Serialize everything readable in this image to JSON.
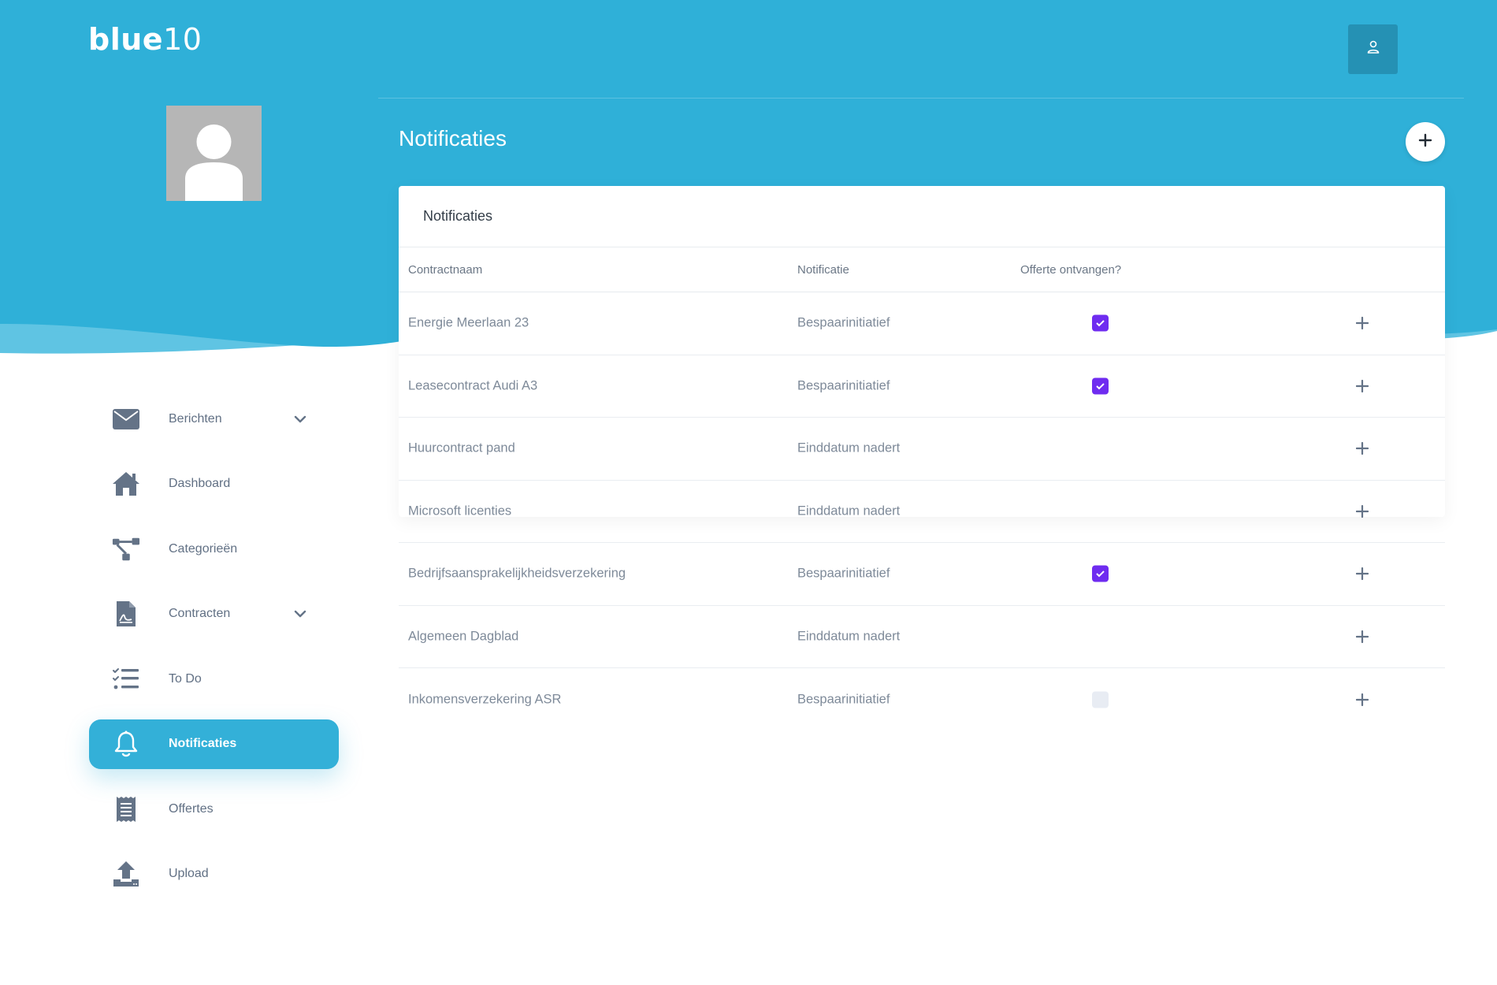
{
  "brand": {
    "logo_bold": "blue",
    "logo_light": "10"
  },
  "header": {
    "user_icon": "user-icon",
    "title": "Notificaties",
    "add_icon": "plus-icon"
  },
  "sidebar": {
    "items": [
      {
        "label": "Berichten",
        "icon": "envelope-icon",
        "has_chevron": true,
        "active": false
      },
      {
        "label": "Dashboard",
        "icon": "home-icon",
        "has_chevron": false,
        "active": false
      },
      {
        "label": "Categorieën",
        "icon": "sitemap-icon",
        "has_chevron": false,
        "active": false
      },
      {
        "label": "Contracten",
        "icon": "contract-file-icon",
        "has_chevron": true,
        "active": false
      },
      {
        "label": "To Do",
        "icon": "checklist-icon",
        "has_chevron": false,
        "active": false
      },
      {
        "label": "Notificaties",
        "icon": "bell-icon",
        "has_chevron": false,
        "active": true
      },
      {
        "label": "Offertes",
        "icon": "receipt-icon",
        "has_chevron": false,
        "active": false
      },
      {
        "label": "Upload",
        "icon": "upload-icon",
        "has_chevron": false,
        "active": false
      }
    ]
  },
  "card": {
    "title": "Notificaties"
  },
  "table": {
    "columns": [
      "Contractnaam",
      "Notificatie",
      "Offerte ontvangen?"
    ],
    "rows": [
      {
        "contract": "Energie Meerlaan 23",
        "notification": "Bespaarinitiatief",
        "quote": "checked"
      },
      {
        "contract": "Leasecontract Audi A3",
        "notification": "Bespaarinitiatief",
        "quote": "checked"
      },
      {
        "contract": "Huurcontract pand",
        "notification": "Einddatum nadert",
        "quote": "none"
      },
      {
        "contract": "Microsoft licenties",
        "notification": "Einddatum nadert",
        "quote": "none"
      },
      {
        "contract": "Bedrijfsaansprakelijkheidsverzekering",
        "notification": "Bespaarinitiatief",
        "quote": "checked"
      },
      {
        "contract": "Algemeen Dagblad",
        "notification": "Einddatum nadert",
        "quote": "none"
      },
      {
        "contract": "Inkomensverzekering ASR",
        "notification": "Bespaarinitiatief",
        "quote": "unchecked"
      }
    ]
  },
  "colors": {
    "primary_blue": "#31b0d8",
    "light_wave": "#5fc4e3",
    "accent_purple": "#6f2cf0",
    "icon_gray": "#647387"
  }
}
